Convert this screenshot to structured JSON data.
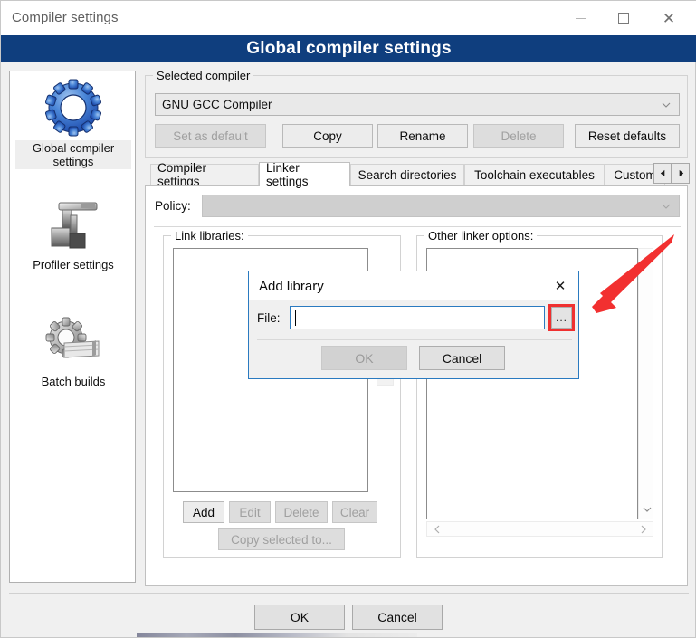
{
  "window": {
    "title": "Compiler settings",
    "minimize_icon": "minimize-icon",
    "maximize_icon": "maximize-icon",
    "close_icon": "close-icon"
  },
  "banner": {
    "title": "Global compiler settings"
  },
  "sidebar": {
    "items": [
      {
        "label": "Global compiler settings",
        "icon": "blue-gear-icon",
        "selected": true
      },
      {
        "label": "Profiler settings",
        "icon": "profiler-tool-icon",
        "selected": false
      },
      {
        "label": "Batch builds",
        "icon": "gear-stack-icon",
        "selected": false
      }
    ]
  },
  "selected_compiler": {
    "group_label": "Selected compiler",
    "combo_value": "GNU GCC Compiler",
    "combo_chevron": "chevron-down-icon",
    "buttons": [
      {
        "label": "Set as default",
        "enabled": false
      },
      {
        "label": "Copy",
        "enabled": true
      },
      {
        "label": "Rename",
        "enabled": true
      },
      {
        "label": "Delete",
        "enabled": false
      },
      {
        "label": "Reset defaults",
        "enabled": true
      }
    ]
  },
  "tabs": {
    "items": [
      {
        "label": "Compiler settings",
        "active": false
      },
      {
        "label": "Linker settings",
        "active": true
      },
      {
        "label": "Search directories",
        "active": false
      },
      {
        "label": "Toolchain executables",
        "active": false
      },
      {
        "label": "Custom",
        "active": false
      }
    ],
    "scroll_left_icon": "triangle-left-icon",
    "scroll_right_icon": "triangle-right-icon"
  },
  "linker_page": {
    "policy_label": "Policy:",
    "policy_value": "",
    "policy_chevron": "chevron-down-icon",
    "link_libraries": {
      "group_label": "Link libraries:",
      "items": [],
      "move_down_icon": "triangle-down-icon",
      "buttons": [
        {
          "label": "Add",
          "enabled": true
        },
        {
          "label": "Edit",
          "enabled": false
        },
        {
          "label": "Delete",
          "enabled": false
        },
        {
          "label": "Clear",
          "enabled": false
        },
        {
          "label": "Copy selected to...",
          "enabled": false
        }
      ]
    },
    "other_linker_options": {
      "group_label": "Other linker options:",
      "value": "",
      "scroll_up_icon": "chevron-up-icon",
      "scroll_down_icon": "chevron-down-icon",
      "scroll_left_icon": "chevron-left-icon",
      "scroll_right_icon": "chevron-right-icon"
    }
  },
  "dialog_buttons": {
    "ok": "OK",
    "cancel": "Cancel"
  },
  "modal": {
    "title": "Add library",
    "close_icon": "close-icon",
    "file_label": "File:",
    "file_value": "",
    "browse_label": "...",
    "browse_highlight_color": "#ef3030",
    "ok": "OK",
    "ok_enabled": false,
    "cancel": "Cancel"
  },
  "annotation": {
    "arrow_color": "#f23030",
    "arrow_target": "modal-browse-button"
  },
  "colors": {
    "banner_bg": "#0f3e7e",
    "dialog_border": "#2a7ac0",
    "window_bg": "#f0f0f0"
  }
}
